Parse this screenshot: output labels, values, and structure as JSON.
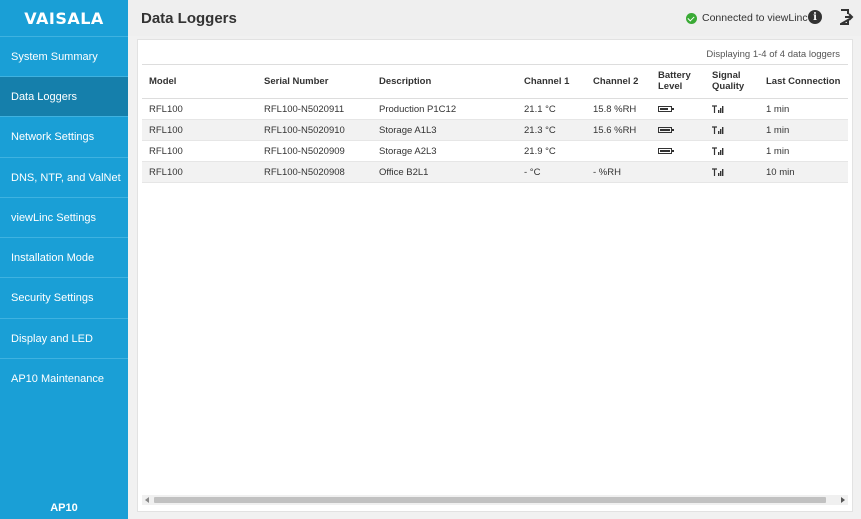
{
  "brand": {
    "logo": "VAISALA",
    "footer": "AP10"
  },
  "sidebar": {
    "items": [
      {
        "label": "System Summary",
        "active": false
      },
      {
        "label": "Data Loggers",
        "active": true
      },
      {
        "label": "Network Settings",
        "active": false
      },
      {
        "label": "DNS, NTP, and ValNet",
        "active": false
      },
      {
        "label": "viewLinc Settings",
        "active": false
      },
      {
        "label": "Installation Mode",
        "active": false
      },
      {
        "label": "Security Settings",
        "active": false
      },
      {
        "label": "Display and LED",
        "active": false
      },
      {
        "label": "AP10 Maintenance",
        "active": false
      }
    ]
  },
  "header": {
    "title": "Data Loggers",
    "status": "Connected to viewLinc",
    "status_color": "#3aaa35",
    "info_icon": "info-icon",
    "logout_icon": "logout-icon"
  },
  "table": {
    "displaying": "Displaying 1-4 of 4 data loggers",
    "columns": [
      "Model",
      "Serial Number",
      "Description",
      "Channel 1",
      "Channel 2",
      "Battery Level",
      "Signal Quality",
      "Last Connection"
    ],
    "rows": [
      {
        "model": "RFL100",
        "serial": "RFL100-N5020911",
        "description": "Production P1C12",
        "ch1": "21.1 °C",
        "ch2": "15.8 %RH",
        "battery": 0.75,
        "signal": 1,
        "last": "1 min"
      },
      {
        "model": "RFL100",
        "serial": "RFL100-N5020910",
        "description": "Storage A1L3",
        "ch1": "21.3 °C",
        "ch2": "15.6 %RH",
        "battery": 1.0,
        "signal": 1,
        "last": "1 min"
      },
      {
        "model": "RFL100",
        "serial": "RFL100-N5020909",
        "description": "Storage A2L3",
        "ch1": "21.9 °C",
        "ch2": "",
        "battery": 1.0,
        "signal": 1,
        "last": "1 min"
      },
      {
        "model": "RFL100",
        "serial": "RFL100-N5020908",
        "description": "Office B2L1",
        "ch1": "- °C",
        "ch2": "- %RH",
        "battery": null,
        "signal": 1,
        "last": "10 min"
      }
    ]
  },
  "colors": {
    "sidebar": "#1a9fd6",
    "sidebar_active": "#157fab"
  }
}
